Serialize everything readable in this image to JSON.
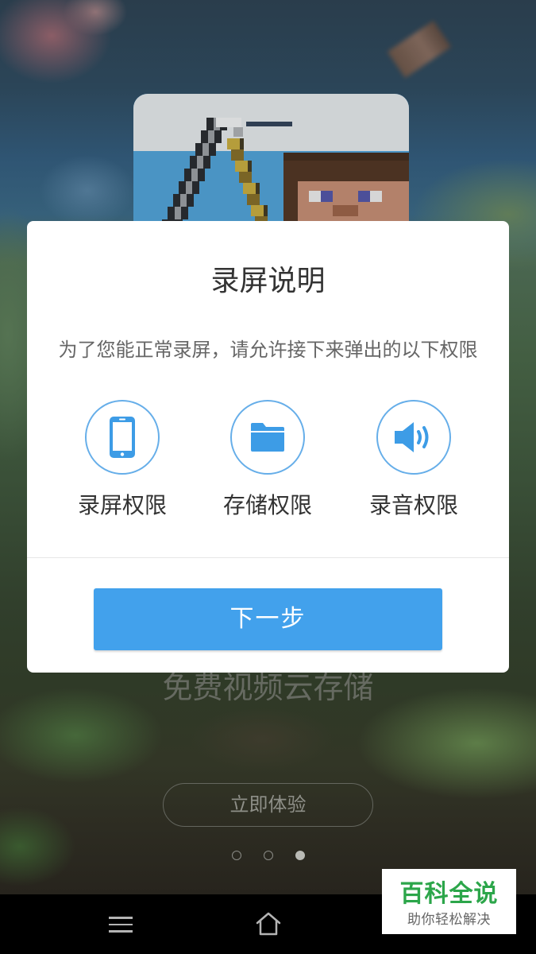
{
  "background": {
    "tagline": "免费视频云存储",
    "cta_label": "立即体验",
    "pager": {
      "pages": 3,
      "active_index": 2
    }
  },
  "dialog": {
    "title": "录屏说明",
    "description": "为了您能正常录屏，请允许接下来弹出的以下权限",
    "permissions": [
      {
        "label": "录屏权限",
        "icon": "phone-icon"
      },
      {
        "label": "存储权限",
        "icon": "folder-icon"
      },
      {
        "label": "录音权限",
        "icon": "speaker-icon"
      }
    ],
    "next_label": "下一步"
  },
  "nav_bar": {
    "buttons": [
      {
        "icon": "menu-icon"
      },
      {
        "icon": "home-icon"
      }
    ]
  },
  "watermark": {
    "title": "百科全说",
    "subtitle": "助你轻松解决"
  },
  "colors": {
    "accent": "#42a1ec",
    "icon": "#3d9ce6",
    "icon_ring": "#66aee9",
    "watermark_green": "#2ca64a",
    "nav_bar": "#000000"
  }
}
